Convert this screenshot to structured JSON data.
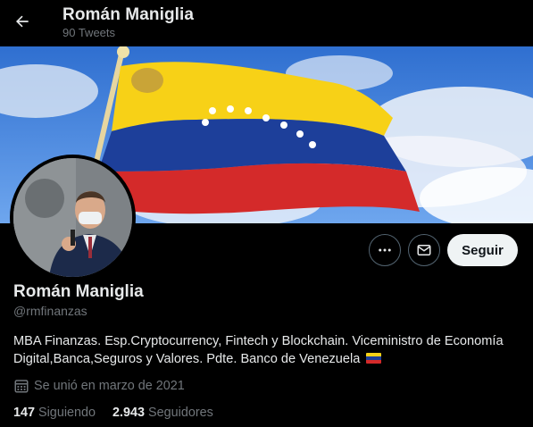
{
  "header": {
    "title": "Román Maniglia",
    "tweet_count": "90 Tweets"
  },
  "profile": {
    "name": "Román Maniglia",
    "handle": "@rmfinanzas",
    "bio": "MBA Finanzas. Esp.Cryptocurrency, Fintech y Blockchain. Viceministro de Economía Digital,Banca,Seguros y Valores. Pdte. Banco de Venezuela",
    "joined": "Se unió en marzo de 2021",
    "following_count": "147",
    "following_label": "Siguiendo",
    "followers_count": "2.943",
    "followers_label": "Seguidores"
  },
  "actions": {
    "follow_label": "Seguir"
  },
  "icons": {
    "back": "arrow-left-icon",
    "more": "more-dots-icon",
    "message": "envelope-icon",
    "calendar": "calendar-icon",
    "flag": "venezuela-flag-icon"
  },
  "colors": {
    "background": "#000000",
    "text_primary": "#e7e9ea",
    "text_secondary": "#71767b",
    "button_border": "#536471",
    "follow_button_bg": "#eff3f4",
    "flag_yellow": "#f7d117",
    "flag_blue": "#1d3f9a",
    "flag_red": "#d42a2a"
  }
}
